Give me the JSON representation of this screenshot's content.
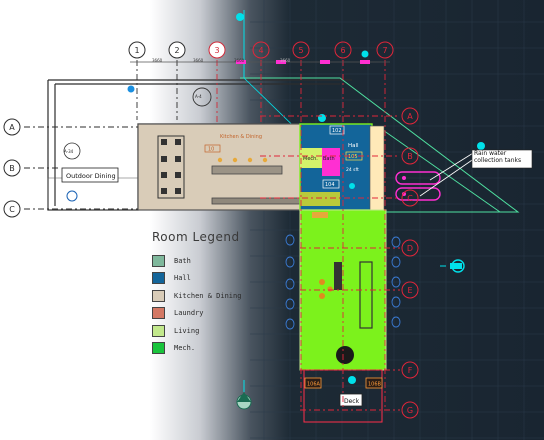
{
  "columns": [
    "1",
    "2",
    "3",
    "4",
    "5",
    "6",
    "7"
  ],
  "rows": [
    "A",
    "B",
    "C",
    "D",
    "E",
    "F",
    "G"
  ],
  "dimension_labels": [
    "3660",
    "3660",
    "3660",
    "3660"
  ],
  "rooms": {
    "kitchen": "Kitchen & Dining",
    "hall": "Hall",
    "mech": "Mech.",
    "bath": "Bath",
    "deck": "Deck",
    "outdoor_dining": "Outdoor Dining"
  },
  "tags": {
    "kitchen_tag": "10",
    "room_102": "102",
    "room_105": "105",
    "room_104": "104",
    "area_24": "24 sft",
    "mark_a": "A-34",
    "mark_b": "A-4",
    "door_106a": "106A",
    "door_106b": "106B"
  },
  "rain_note": "Rain water collection tanks",
  "legend": {
    "title": "Room Legend",
    "items": [
      {
        "label": "Bath",
        "color": "#7fb89c"
      },
      {
        "label": "Hall",
        "color": "#13659a"
      },
      {
        "label": "Kitchen & Dining",
        "color": "#d9ccb8"
      },
      {
        "label": "Laundry",
        "color": "#d47864"
      },
      {
        "label": "Living",
        "color": "#c2e88c"
      },
      {
        "label": "Mech.",
        "color": "#19c43c"
      }
    ]
  },
  "colors": {
    "gridline": "#e0263a",
    "living": "#7cf21c",
    "hall": "#13659a",
    "kitchen": "#d9ccb8",
    "cyan": "#00e1ea",
    "magenta": "#ff2fd2"
  }
}
